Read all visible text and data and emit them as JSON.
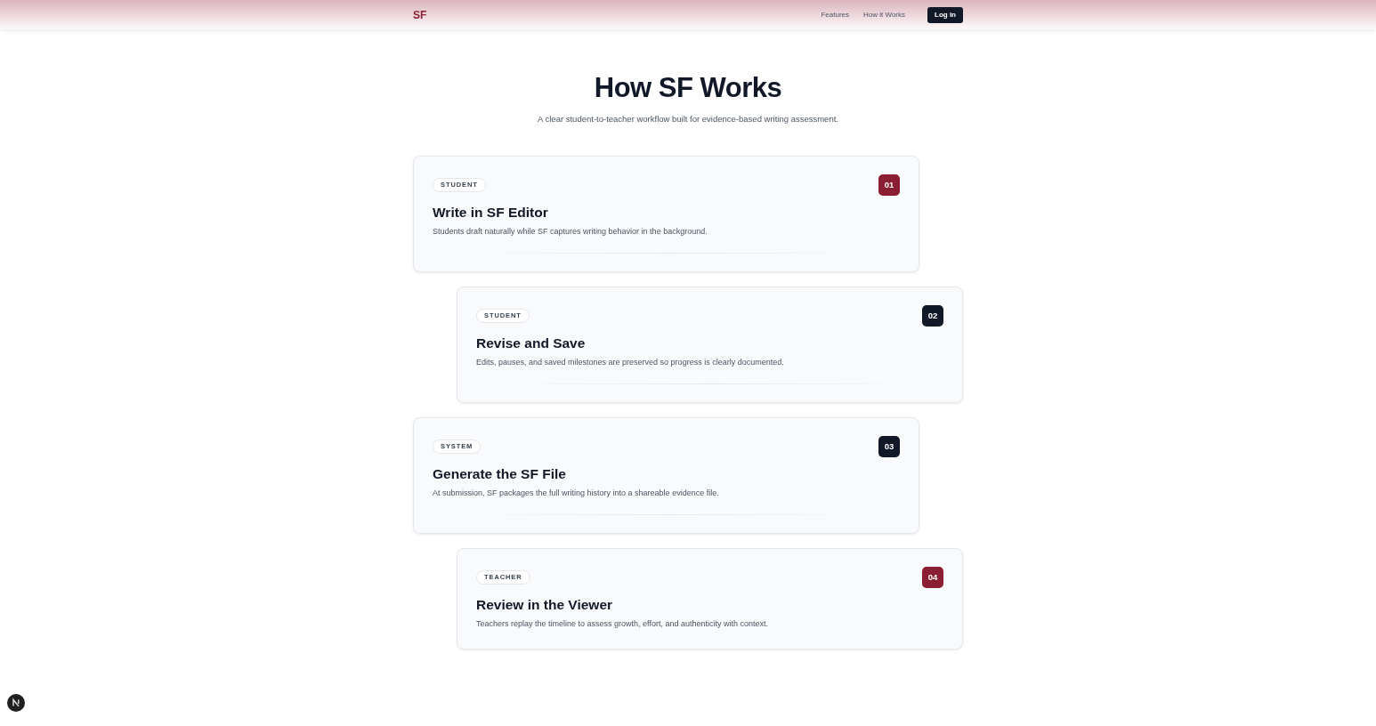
{
  "nav": {
    "logo": "SF",
    "links": [
      "Features",
      "How it Works"
    ],
    "login_button": "Log in"
  },
  "hero": {
    "title": "How SF Works",
    "subtitle": "A clear student-to-teacher workflow built for evidence-based writing assessment."
  },
  "steps": [
    {
      "role": "STUDENT",
      "number": "01",
      "color": "#8b1e32",
      "title": "Write in SF Editor",
      "description": "Students draft naturally while SF captures writing behavior in the background."
    },
    {
      "role": "STUDENT",
      "number": "02",
      "color": "#111827",
      "title": "Revise and Save",
      "description": "Edits, pauses, and saved milestones are preserved so progress is clearly documented."
    },
    {
      "role": "SYSTEM",
      "number": "03",
      "color": "#111827",
      "title": "Generate the SF File",
      "description": "At submission, SF packages the full writing history into a shareable evidence file."
    },
    {
      "role": "TEACHER",
      "number": "04",
      "color": "#8b1e32",
      "title": "Review in the Viewer",
      "description": "Teachers replay the timeline to assess growth, effort, and authenticity with context."
    }
  ]
}
